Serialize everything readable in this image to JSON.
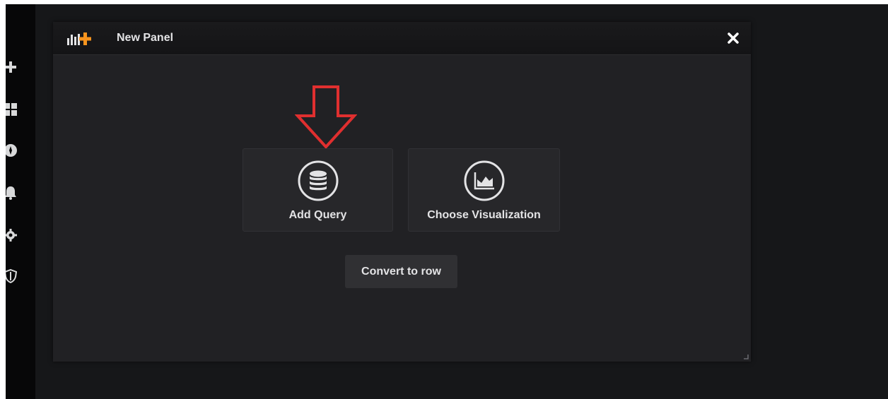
{
  "panel": {
    "title": "New Panel",
    "close_icon": "close-icon",
    "logo_icon": "panel-add-logo-icon"
  },
  "actions": {
    "add_query": {
      "label": "Add Query",
      "icon": "database-icon"
    },
    "choose_visualization": {
      "label": "Choose Visualization",
      "icon": "area-chart-icon"
    },
    "convert_to_row": {
      "label": "Convert to row"
    }
  },
  "sidebar": {
    "items": [
      {
        "icon": "plus-icon"
      },
      {
        "icon": "dashboards-icon"
      },
      {
        "icon": "explore-compass-icon"
      },
      {
        "icon": "bell-icon"
      },
      {
        "icon": "gear-icon"
      },
      {
        "icon": "shield-icon"
      }
    ]
  },
  "annotation": {
    "icon": "red-arrow-down-icon",
    "color": "#e02f2f"
  },
  "colors": {
    "background": "#161719",
    "panel": "#212124",
    "accent": "#f7941e",
    "text": "#e3e3e5"
  }
}
